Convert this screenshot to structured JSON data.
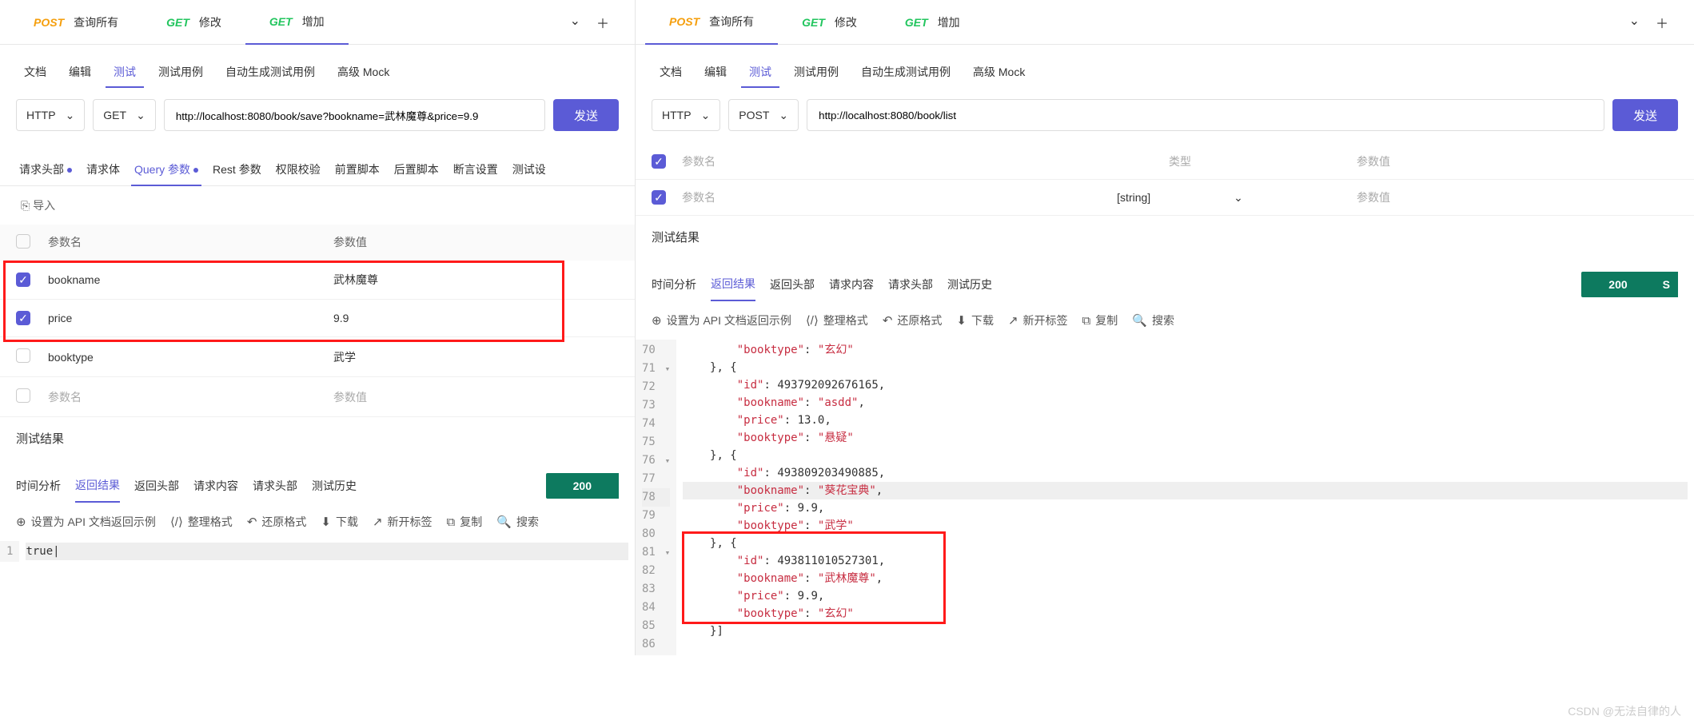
{
  "left": {
    "tabs": [
      {
        "method": "POST",
        "label": "查询所有"
      },
      {
        "method": "GET",
        "label": "修改"
      },
      {
        "method": "GET",
        "label": "增加"
      }
    ],
    "subTabs": [
      "文档",
      "编辑",
      "测试",
      "测试用例",
      "自动生成测试用例",
      "高级 Mock"
    ],
    "subTabActive": 2,
    "protocol": "HTTP",
    "method": "GET",
    "url": "http://localhost:8080/book/save?bookname=武林魔尊&price=9.9",
    "sendLabel": "发送",
    "paramTabs": [
      {
        "label": "请求头部",
        "dot": true
      },
      {
        "label": "请求体",
        "dot": false
      },
      {
        "label": "Query 参数",
        "dot": true,
        "active": true
      },
      {
        "label": "Rest 参数",
        "dot": false
      },
      {
        "label": "权限校验",
        "dot": false
      },
      {
        "label": "前置脚本",
        "dot": false
      },
      {
        "label": "后置脚本",
        "dot": false
      },
      {
        "label": "断言设置",
        "dot": false
      },
      {
        "label": "测试设",
        "dot": false
      }
    ],
    "importLabel": "导入",
    "paramsHeader": {
      "name": "参数名",
      "value": "参数值"
    },
    "params": [
      {
        "checked": true,
        "name": "bookname",
        "value": "武林魔尊"
      },
      {
        "checked": true,
        "name": "price",
        "value": "9.9"
      },
      {
        "checked": false,
        "name": "booktype",
        "value": "武学"
      }
    ],
    "paramsPlaceholder": {
      "name": "参数名",
      "value": "参数值"
    },
    "resultTitle": "测试结果",
    "resultTabs": [
      "时间分析",
      "返回结果",
      "返回头部",
      "请求内容",
      "请求头部",
      "测试历史"
    ],
    "resultTabActive": 1,
    "statusCode": "200",
    "toolbar": {
      "setExample": "设置为 API 文档返回示例",
      "format": "整理格式",
      "restore": "还原格式",
      "download": "下载",
      "newTab": "新开标签",
      "copy": "复制",
      "search": "搜索"
    },
    "codeLine": "1",
    "codeBody": "true"
  },
  "right": {
    "tabs": [
      {
        "method": "POST",
        "label": "查询所有"
      },
      {
        "method": "GET",
        "label": "修改"
      },
      {
        "method": "GET",
        "label": "增加"
      }
    ],
    "subTabs": [
      "文档",
      "编辑",
      "测试",
      "测试用例",
      "自动生成测试用例",
      "高级 Mock"
    ],
    "subTabActive": 2,
    "protocol": "HTTP",
    "method": "POST",
    "url": "http://localhost:8080/book/list",
    "sendLabel": "发送",
    "headerRow": {
      "name": "参数名",
      "type": "类型",
      "value": "参数值"
    },
    "inputRow": {
      "namePh": "参数名",
      "type": "[string]",
      "valuePh": "参数值"
    },
    "resultTitle": "测试结果",
    "resultTabs": [
      "时间分析",
      "返回结果",
      "返回头部",
      "请求内容",
      "请求头部",
      "测试历史"
    ],
    "resultTabActive": 1,
    "statusCode": "200",
    "statusS": "S",
    "toolbar": {
      "setExample": "设置为 API 文档返回示例",
      "format": "整理格式",
      "restore": "还原格式",
      "download": "下载",
      "newTab": "新开标签",
      "copy": "复制",
      "search": "搜索"
    },
    "code": {
      "lines": [
        {
          "n": 70,
          "indent": 8,
          "tokens": [
            [
              "key",
              "\"booktype\""
            ],
            [
              "punc",
              ": "
            ],
            [
              "str",
              "\"玄幻\""
            ]
          ]
        },
        {
          "n": 71,
          "fold": true,
          "indent": 4,
          "tokens": [
            [
              "punc",
              "}, {"
            ]
          ]
        },
        {
          "n": 72,
          "indent": 8,
          "tokens": [
            [
              "key",
              "\"id\""
            ],
            [
              "punc",
              ": "
            ],
            [
              "num",
              "493792092676165"
            ],
            [
              "punc",
              ","
            ]
          ]
        },
        {
          "n": 73,
          "indent": 8,
          "tokens": [
            [
              "key",
              "\"bookname\""
            ],
            [
              "punc",
              ": "
            ],
            [
              "str",
              "\"asdd\""
            ],
            [
              "punc",
              ","
            ]
          ]
        },
        {
          "n": 74,
          "indent": 8,
          "tokens": [
            [
              "key",
              "\"price\""
            ],
            [
              "punc",
              ": "
            ],
            [
              "num",
              "13.0"
            ],
            [
              "punc",
              ","
            ]
          ]
        },
        {
          "n": 75,
          "indent": 8,
          "tokens": [
            [
              "key",
              "\"booktype\""
            ],
            [
              "punc",
              ": "
            ],
            [
              "str",
              "\"悬疑\""
            ]
          ]
        },
        {
          "n": 76,
          "fold": true,
          "indent": 4,
          "tokens": [
            [
              "punc",
              "}, {"
            ]
          ]
        },
        {
          "n": 77,
          "indent": 8,
          "tokens": [
            [
              "key",
              "\"id\""
            ],
            [
              "punc",
              ": "
            ],
            [
              "num",
              "493809203490885"
            ],
            [
              "punc",
              ","
            ]
          ]
        },
        {
          "n": 78,
          "hl": true,
          "indent": 8,
          "tokens": [
            [
              "key",
              "\"bookname\""
            ],
            [
              "punc",
              ": "
            ],
            [
              "str",
              "\"葵花宝典\""
            ],
            [
              "punc",
              ","
            ]
          ]
        },
        {
          "n": 79,
          "indent": 8,
          "tokens": [
            [
              "key",
              "\"price\""
            ],
            [
              "punc",
              ": "
            ],
            [
              "num",
              "9.9"
            ],
            [
              "punc",
              ","
            ]
          ]
        },
        {
          "n": 80,
          "indent": 8,
          "tokens": [
            [
              "key",
              "\"booktype\""
            ],
            [
              "punc",
              ": "
            ],
            [
              "str",
              "\"武学\""
            ]
          ]
        },
        {
          "n": 81,
          "fold": true,
          "indent": 4,
          "tokens": [
            [
              "punc",
              "}, {"
            ]
          ]
        },
        {
          "n": 82,
          "indent": 8,
          "tokens": [
            [
              "key",
              "\"id\""
            ],
            [
              "punc",
              ": "
            ],
            [
              "num",
              "493811010527301"
            ],
            [
              "punc",
              ","
            ]
          ]
        },
        {
          "n": 83,
          "indent": 8,
          "tokens": [
            [
              "key",
              "\"bookname\""
            ],
            [
              "punc",
              ": "
            ],
            [
              "str",
              "\"武林魔尊\""
            ],
            [
              "punc",
              ","
            ]
          ]
        },
        {
          "n": 84,
          "indent": 8,
          "tokens": [
            [
              "key",
              "\"price\""
            ],
            [
              "punc",
              ": "
            ],
            [
              "num",
              "9.9"
            ],
            [
              "punc",
              ","
            ]
          ]
        },
        {
          "n": 85,
          "indent": 8,
          "tokens": [
            [
              "key",
              "\"booktype\""
            ],
            [
              "punc",
              ": "
            ],
            [
              "str",
              "\"玄幻\""
            ]
          ]
        },
        {
          "n": 86,
          "indent": 4,
          "tokens": [
            [
              "punc",
              "}]"
            ]
          ]
        }
      ]
    }
  },
  "watermark": "CSDN @无法自律的人"
}
